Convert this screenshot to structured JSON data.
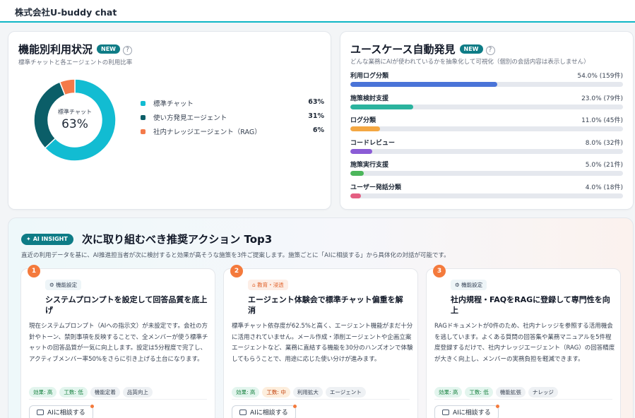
{
  "app": {
    "title": "株式会社U-buddy chat"
  },
  "feature_usage": {
    "title": "機能別利用状況",
    "badge": "NEW",
    "help": "?",
    "subtitle": "標準チャットと各エージェントの利用比率",
    "donut_center_label": "標準チャット",
    "donut_center_value": "63%",
    "items": [
      {
        "label": "標準チャット",
        "percent": 63,
        "percent_text": "63%",
        "color": "#12bcd2"
      },
      {
        "label": "使い方発見エージェント",
        "percent": 31,
        "percent_text": "31%",
        "color": "#0b5e68"
      },
      {
        "label": "社内ナレッジエージェント（RAG）",
        "percent": 6,
        "percent_text": "6%",
        "color": "#f47a4a"
      }
    ]
  },
  "use_cases": {
    "title": "ユースケース自動発見",
    "badge": "NEW",
    "help": "?",
    "subtitle": "どんな業務にAIが使われているかを抽象化して可視化（個別の会話内容は表示しません）",
    "items": [
      {
        "label": "利用ログ分類",
        "value_text": "54.0% (159件)",
        "percent": 54.0,
        "color": "#4a74d8"
      },
      {
        "label": "施策検討支援",
        "value_text": "23.0% (79件)",
        "percent": 23.0,
        "color": "#2bb39e"
      },
      {
        "label": "ログ分類",
        "value_text": "11.0% (45件)",
        "percent": 11.0,
        "color": "#f4a742"
      },
      {
        "label": "コードレビュー",
        "value_text": "8.0% (32件)",
        "percent": 8.0,
        "color": "#8b5cd6"
      },
      {
        "label": "施策実行支援",
        "value_text": "5.0% (21件)",
        "percent": 5.0,
        "color": "#4cb65b"
      },
      {
        "label": "ユーザー発話分類",
        "value_text": "4.0% (18件)",
        "percent": 4.0,
        "color": "#e45f82"
      }
    ]
  },
  "insight": {
    "pill": "AI INSIGHT",
    "title": "次に取り組むべき推奨アクション Top3",
    "subtitle": "直近の利用データを基に、AI推進担当者が次に検討すると効果が高そうな施策を3件ご提案します。施策ごとに「AIに相談する」から具体化の対話が可能です。",
    "consult_label": "AIに相談する",
    "recommendations": [
      {
        "number": "1",
        "category": "機能設定",
        "category_style": "blue",
        "title": "システムプロンプトを設定して回答品質を底上げ",
        "description": "現在システムプロンプト（AIへの指示文）が未設定です。会社の方針やトーン、禁則事項を反映することで、全メンバーが使う標準チャットの回答品質が一気に向上します。設定は5分程度で完了し、アクティブメンバー率50%をさらに引き上げる土台になります。",
        "tags": [
          {
            "text": "効果: 高",
            "style": "green"
          },
          {
            "text": "工数: 低",
            "style": "green"
          },
          {
            "text": "機能定着",
            "style": "gray"
          },
          {
            "text": "品質向上",
            "style": "gray"
          }
        ]
      },
      {
        "number": "2",
        "category": "教育・浸透",
        "category_style": "orange",
        "title": "エージェント体験会で標準チャット偏重を解消",
        "description": "標準チャット依存度が62.5%と高く、エージェント機能がまだ十分に活用されていません。メール作成・添削エージェントや企画立案エージェントなど、業務に直結する機能を30分のハンズオンで体験してもらうことで、用途に応じた使い分けが進みます。",
        "tags": [
          {
            "text": "効果: 高",
            "style": "green"
          },
          {
            "text": "工数: 中",
            "style": "orange"
          },
          {
            "text": "利用拡大",
            "style": "gray"
          },
          {
            "text": "エージェント",
            "style": "gray"
          }
        ]
      },
      {
        "number": "3",
        "category": "機能設定",
        "category_style": "blue",
        "title": "社内規程・FAQをRAGに登録して専門性を向上",
        "description": "RAGドキュメントが0件のため、社内ナレッジを参照する活用機会を逃しています。よくある質問の回答集や業務マニュアルを5件程度登録するだけで、社内ナレッジエージェント（RAG）の回答精度が大きく向上し、メンバーの実務負担を軽減できます。",
        "tags": [
          {
            "text": "効果: 高",
            "style": "green"
          },
          {
            "text": "工数: 低",
            "style": "green"
          },
          {
            "text": "機能拡張",
            "style": "gray"
          },
          {
            "text": "ナレッジ",
            "style": "gray"
          }
        ]
      }
    ]
  }
}
